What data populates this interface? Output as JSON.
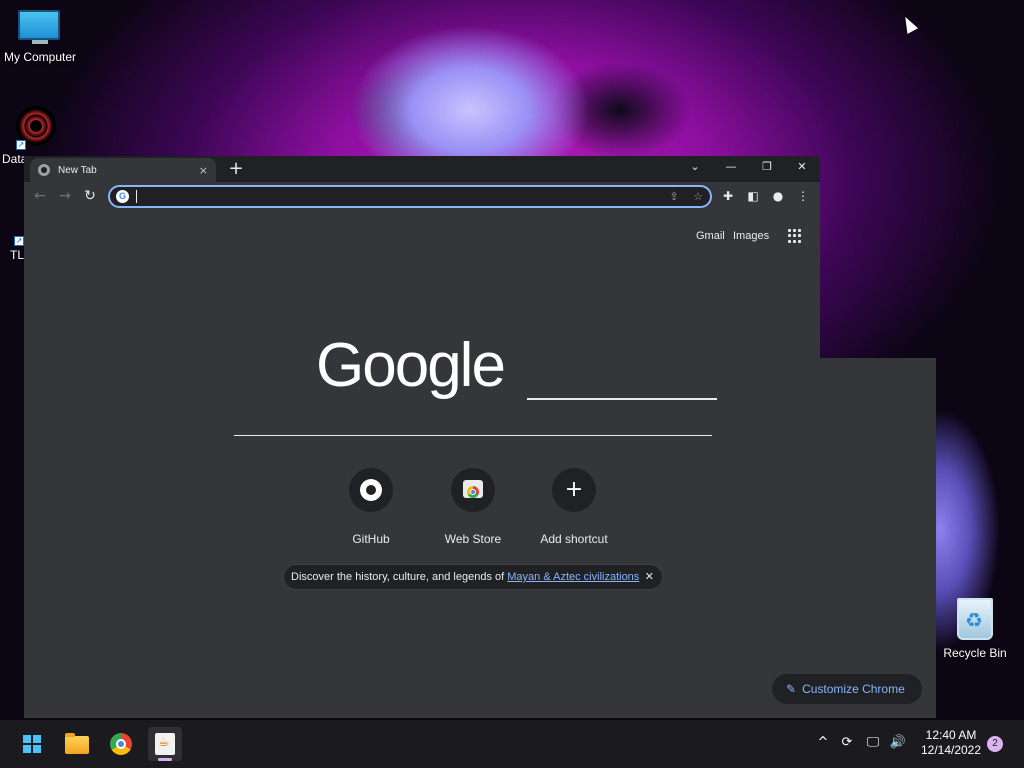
{
  "desktop": {
    "icons": [
      {
        "label": "My Computer",
        "icon": "monitor-icon"
      },
      {
        "label": "Data",
        "icon": "shortcut-icon"
      },
      {
        "label": "TL",
        "icon": "shortcut-icon"
      },
      {
        "label": "Recycle Bin",
        "icon": "recycle-bin-icon"
      }
    ]
  },
  "browser": {
    "tab": {
      "title": "New Tab",
      "close": "×"
    },
    "new_tab": "+",
    "window_controls": {
      "dropdown": "⌄",
      "minimize": "—",
      "restore": "❐",
      "close": "✕"
    },
    "nav": {
      "back": "←",
      "forward": "→",
      "reload": "↻"
    },
    "omnibox": {
      "value": "",
      "placeholder": ""
    },
    "toolbar_icons": [
      "share-icon",
      "bookmark-star-icon",
      "extensions-icon",
      "side-panel-icon",
      "profile-icon",
      "menu-icon"
    ]
  },
  "ntp": {
    "links": {
      "gmail": "Gmail",
      "images": "Images"
    },
    "logo_text": "Google",
    "shortcuts": [
      {
        "label": "GitHub",
        "icon": "github-icon"
      },
      {
        "label": "Web Store",
        "icon": "web-store-icon"
      },
      {
        "label": "Add shortcut",
        "icon": "plus-icon",
        "glyph": "+"
      }
    ],
    "promo": {
      "text": "Discover the history, culture, and legends of ",
      "link": "Mayan & Aztec civilizations",
      "close": "✕"
    },
    "customize": {
      "label": "Customize Chrome",
      "icon": "✎"
    }
  },
  "taskbar": {
    "apps": [
      "start-icon",
      "file-explorer-icon",
      "chrome-icon",
      "java-icon"
    ],
    "tray": {
      "chevron": "^",
      "sync": "⟳",
      "network": "🖵",
      "volume": "🔊"
    },
    "clock": {
      "time": "12:40 AM",
      "date": "12/14/2022"
    },
    "notification_count": "2"
  }
}
